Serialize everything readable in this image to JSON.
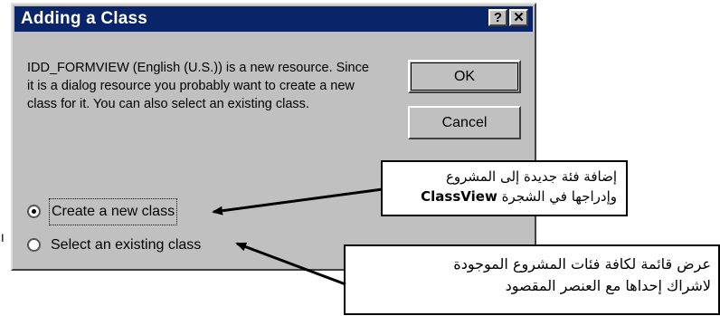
{
  "dialog": {
    "title": "Adding a Class",
    "help_glyph": "?",
    "close_glyph": "✕",
    "message": "IDD_FORMVIEW (English (U.S.)) is a new resource. Since it is a dialog resource you probably want to create a new class for it. You can also select an existing class.",
    "ok_label": "OK",
    "cancel_label": "Cancel",
    "options": [
      {
        "label": "Create a new class",
        "selected": true
      },
      {
        "label": "Select an existing class",
        "selected": false
      }
    ]
  },
  "callouts": [
    {
      "lines": [
        "إضافة فئة جديدة إلى المشروع"
      ],
      "line2_prefix": "وإدراجها في الشجرة",
      "line2_emphasis": "ClassView"
    },
    {
      "lines": [
        "عرض قائمة لكافة فئات المشروع الموجودة",
        "لاشراك إحداها مع العنصر المقصود"
      ]
    }
  ],
  "stray_text": "ו",
  "colors": {
    "titlebar": "#0a246a",
    "dialog_face": "#c0c0c0",
    "arrow": "#000000"
  }
}
